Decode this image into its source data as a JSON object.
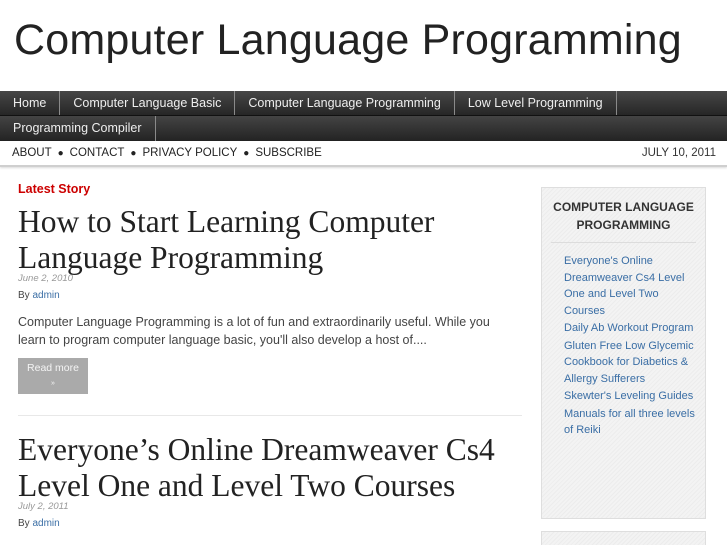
{
  "site": {
    "title": "Computer Language Programming"
  },
  "nav": {
    "row1": [
      {
        "label": "Home"
      },
      {
        "label": "Computer Language Basic"
      },
      {
        "label": "Computer Language Programming"
      },
      {
        "label": "Low Level Programming"
      }
    ],
    "row2": [
      {
        "label": "Programming Compiler"
      }
    ]
  },
  "subnav": {
    "links": [
      {
        "label": "About"
      },
      {
        "label": "Contact"
      },
      {
        "label": "Privacy Policy"
      },
      {
        "label": "Subscribe"
      }
    ],
    "separator": "●",
    "date": "JULY 10, 2011"
  },
  "main": {
    "section_label": "Latest Story",
    "posts": [
      {
        "title": "How to Start Learning Computer Language Programming",
        "date": "June 2, 2010",
        "by": "By",
        "author": "admin",
        "excerpt": "Computer Language Programming is a lot of fun and extraordinarily useful. While you learn to program computer language basic, you'll also develop a host of....",
        "read_more": "Read more",
        "read_more_arrow": "»"
      },
      {
        "title": "Everyone’s Online Dreamweaver Cs4 Level One and Level Two Courses",
        "date": "July 2, 2011",
        "by": "By",
        "author": "admin"
      }
    ]
  },
  "sidebar": {
    "widget_title": "COMPUTER LANGUAGE PROGRAMMING",
    "links": [
      "Everyone's Online Dreamweaver Cs4 Level One and Level Two Courses",
      "Daily Ab Workout Program",
      "Gluten Free Low Glycemic Cookbook for Diabetics & Allergy Sufferers",
      "Skewter's Leveling Guides",
      "Manuals for all three levels of Reiki"
    ]
  },
  "colors": {
    "accent_red": "#cc0000",
    "link_blue": "#3a6ea5",
    "nav_dark": "#2b2b2b",
    "read_more_bg": "#aaaaaa"
  }
}
